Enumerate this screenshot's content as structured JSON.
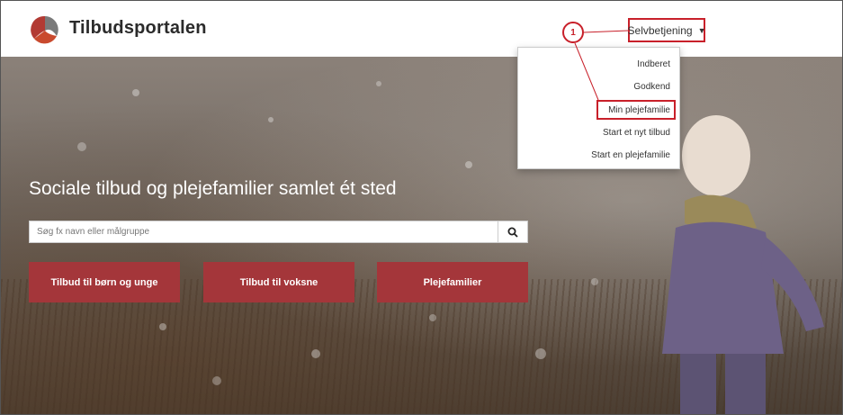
{
  "header": {
    "brand": "Tilbudsportalen",
    "selfservice_label": "Selvbetjening"
  },
  "dropdown": {
    "items": [
      {
        "label": "Indberet"
      },
      {
        "label": "Godkend"
      },
      {
        "label": "Min plejefamilie"
      },
      {
        "label": "Start et nyt tilbud"
      },
      {
        "label": "Start en plejefamilie"
      }
    ]
  },
  "hero": {
    "title": "Sociale tilbud og plejefamilier samlet ét sted",
    "search_placeholder": "Søg fx navn eller målgruppe",
    "buttons": [
      {
        "label": "Tilbud til børn og unge"
      },
      {
        "label": "Tilbud til voksne"
      },
      {
        "label": "Plejefamilier"
      }
    ]
  },
  "annotation": {
    "step_number": "1"
  },
  "colors": {
    "accent": "#a4363a",
    "highlight": "#c8202a"
  },
  "icons": {
    "logo": "tilbudsportalen-logo",
    "search": "search-icon",
    "caret": "caret-down-icon"
  }
}
